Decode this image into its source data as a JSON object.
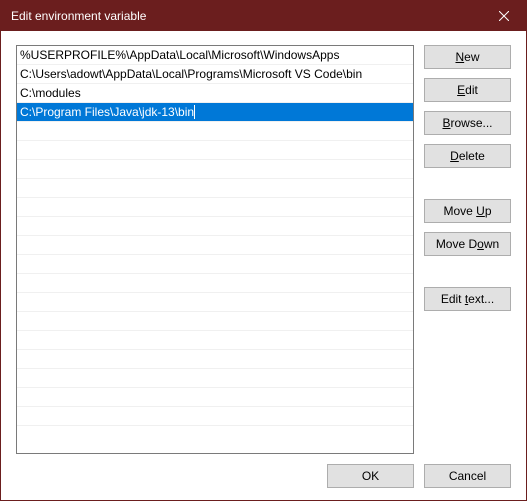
{
  "window": {
    "title": "Edit environment variable"
  },
  "entries": [
    "%USERPROFILE%\\AppData\\Local\\Microsoft\\WindowsApps",
    "C:\\Users\\adowt\\AppData\\Local\\Programs\\Microsoft VS Code\\bin",
    "C:\\modules",
    "C:\\Program Files\\Java\\jdk-13\\bin"
  ],
  "selected_index": 3,
  "buttons": {
    "new": {
      "pre": "",
      "u": "N",
      "post": "ew"
    },
    "edit": {
      "pre": "",
      "u": "E",
      "post": "dit"
    },
    "browse": {
      "pre": "",
      "u": "B",
      "post": "rowse..."
    },
    "delete": {
      "pre": "",
      "u": "D",
      "post": "elete"
    },
    "moveup": {
      "pre": "Move ",
      "u": "U",
      "post": "p"
    },
    "movedown": {
      "pre": "Move D",
      "u": "o",
      "post": "wn"
    },
    "edittext": {
      "pre": "Edit ",
      "u": "t",
      "post": "ext..."
    },
    "ok": "OK",
    "cancel": "Cancel"
  }
}
